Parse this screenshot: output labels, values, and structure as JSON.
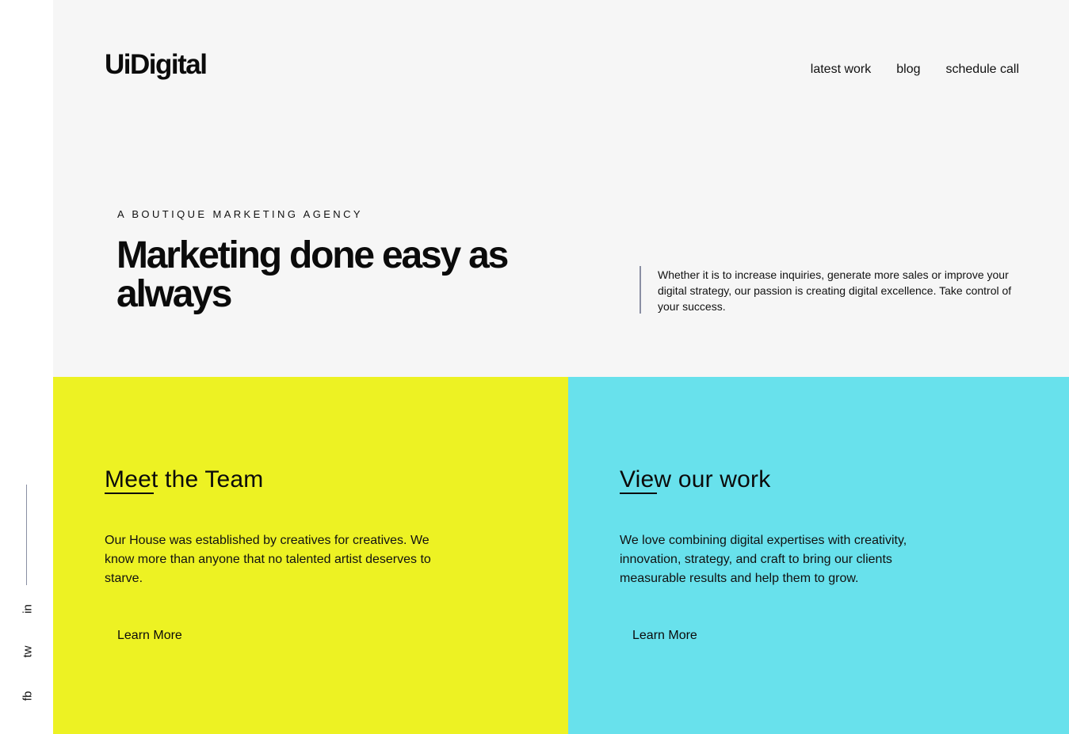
{
  "brand": {
    "logo": "UiDigital"
  },
  "nav": {
    "items": [
      "latest work",
      "blog",
      "schedule call"
    ]
  },
  "sidebar": {
    "social": [
      "in",
      "tw",
      "fb"
    ]
  },
  "hero": {
    "eyebrow": "A BOUTIQUE MARKETING AGENCY",
    "headline": "Marketing done easy as always",
    "intro": "Whether it is to increase inquiries, generate more sales or improve your digital strategy, our passion is creating digital excellence. Take control of your success."
  },
  "cards": [
    {
      "title": "Meet the Team",
      "body": "Our House was established by creatives for creatives. We know more than anyone that no talented artist deserves to starve.",
      "cta": "Learn More",
      "color": "#edf223"
    },
    {
      "title": "View our work",
      "body": "We love combining digital expertises with creativity, innovation, strategy, and craft to bring our clients measurable results and help them to grow.",
      "cta": "Learn More",
      "color": "#68e1ec"
    }
  ],
  "colors": {
    "hero_bg": "#f6f6f6",
    "accent_line": "#8a8fa3"
  }
}
